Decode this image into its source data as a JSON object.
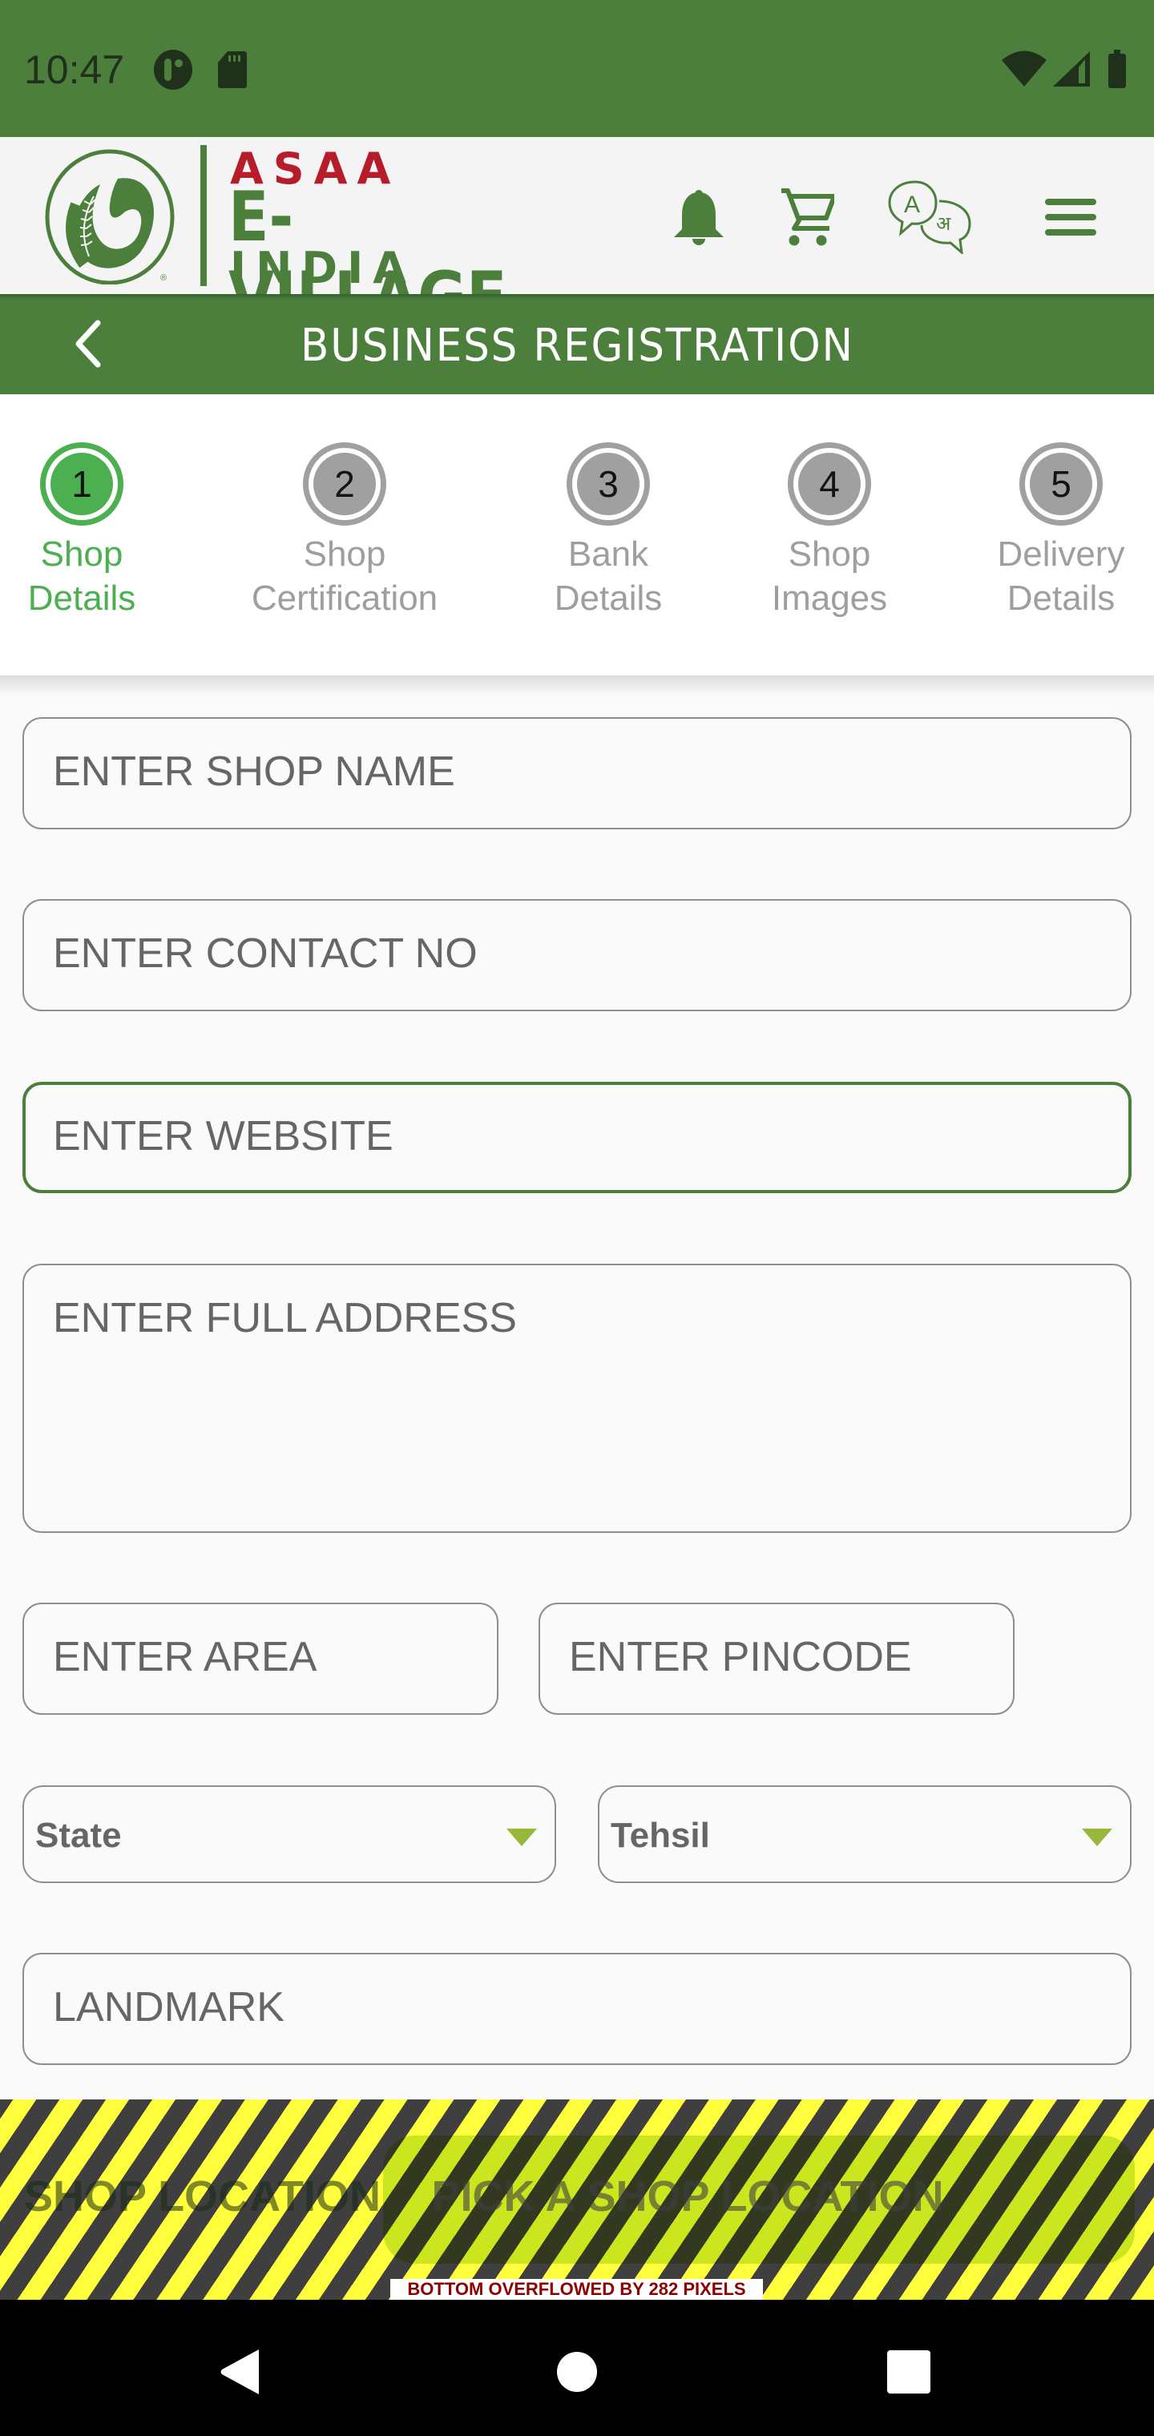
{
  "status_bar": {
    "time": "10:47",
    "left_icons": [
      "app-notification-icon",
      "sd-card-icon"
    ],
    "right_icons": [
      "wifi-icon",
      "cell-signal-icon",
      "battery-icon"
    ]
  },
  "header": {
    "brand_line1": "ASAA",
    "brand_line2": "E-VILLAGE",
    "brand_line3": "INDIA",
    "registered_mark": "®",
    "translate_glyph_a": "A",
    "translate_glyph_hi": "अ",
    "icons": [
      "bell-icon",
      "cart-icon",
      "translate-icon",
      "menu-icon"
    ]
  },
  "title_bar": {
    "title": "BUSINESS REGISTRATION"
  },
  "stepper": {
    "active_step": 1,
    "steps": [
      {
        "number": "1",
        "line1": "Shop",
        "line2": "Details"
      },
      {
        "number": "2",
        "line1": "Shop",
        "line2": "Certification"
      },
      {
        "number": "3",
        "line1": "Bank",
        "line2": "Details"
      },
      {
        "number": "4",
        "line1": "Shop",
        "line2": "Images"
      },
      {
        "number": "5",
        "line1": "Delivery",
        "line2": "Details"
      }
    ]
  },
  "form": {
    "shop_name": {
      "placeholder": "ENTER SHOP NAME",
      "value": ""
    },
    "contact_no": {
      "placeholder": "ENTER CONTACT NO",
      "value": ""
    },
    "website": {
      "placeholder": "ENTER WEBSITE",
      "value": "",
      "focused": true
    },
    "full_address": {
      "placeholder": "ENTER FULL ADDRESS",
      "value": ""
    },
    "area": {
      "placeholder": "ENTER AREA",
      "value": ""
    },
    "pincode": {
      "placeholder": "ENTER PINCODE",
      "value": ""
    },
    "state": {
      "selected": "State"
    },
    "tehsil": {
      "selected": "Tehsil"
    },
    "landmark": {
      "placeholder": "LANDMARK",
      "value": ""
    },
    "shop_location_label": "SHOP LOCATION",
    "pick_location_button": "PICK A SHOP LOCATION"
  },
  "overflow_warning": "BOTTOM OVERFLOWED BY 282 PIXELS",
  "colors": {
    "brand_green": "#4c7f3c",
    "step_active": "#4caf50",
    "step_inactive": "#a0a0a0",
    "brand_red": "#b71c2b",
    "dropdown_arrow": "#98b83a",
    "overflow_text": "#8b0000"
  }
}
